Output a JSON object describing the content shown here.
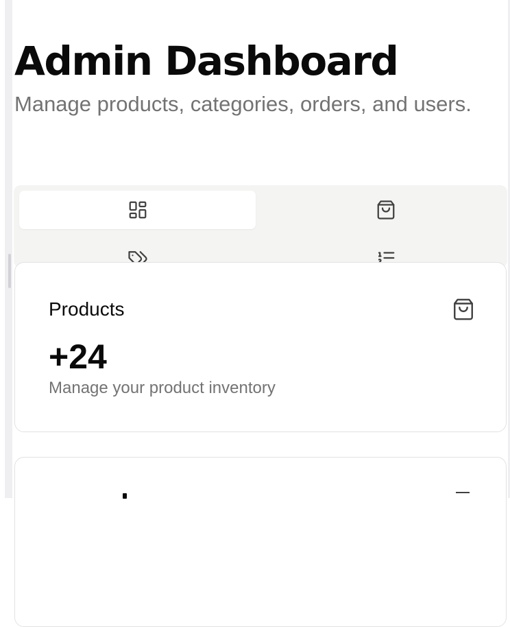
{
  "page": {
    "title": "Admin Dashboard",
    "subtitle": "Manage products, categories, orders, and users."
  },
  "tabs": [
    {
      "id": "overview",
      "icon": "layout-grid-icon",
      "active": true
    },
    {
      "id": "products",
      "icon": "shopping-bag-icon",
      "active": false
    },
    {
      "id": "categories",
      "icon": "tags-icon",
      "active": false
    },
    {
      "id": "orders",
      "icon": "list-ordered-icon",
      "active": false
    }
  ],
  "cards": [
    {
      "title": "Products",
      "icon": "shopping-bag-icon",
      "value": "+24",
      "description": "Manage your product inventory"
    }
  ],
  "colors": {
    "text": "#0a0a0a",
    "muted": "#737373",
    "tab_bg": "#f4f4f3",
    "border": "#e2e2e2"
  }
}
